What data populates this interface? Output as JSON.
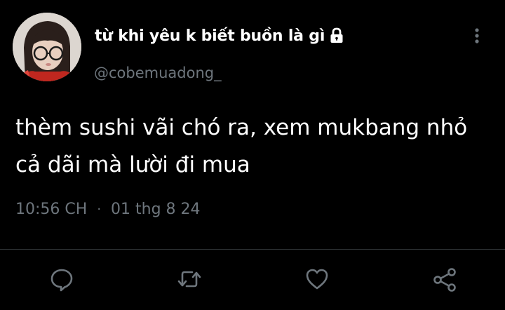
{
  "tweet": {
    "display_name": "từ khi yêu k biết buồn là gì",
    "handle": "@cobemuadong_",
    "text": "thèm sushi vãi chó ra, xem mukbang nhỏ\ncả dãi mà lười đi mua",
    "time": "10:56 CH",
    "separator": "·",
    "date": "01 thg 8 24",
    "protected": true
  },
  "icons": {
    "lock": "lock-icon",
    "more": "more-vertical-icon",
    "reply": "reply-icon",
    "retweet": "retweet-icon",
    "like": "heart-icon",
    "share": "share-icon"
  },
  "colors": {
    "background": "#000000",
    "text": "#ffffff",
    "secondary": "#6e767d",
    "divider": "#2f3336"
  }
}
